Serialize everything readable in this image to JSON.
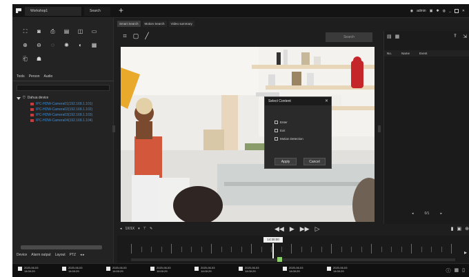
{
  "titlebar": {
    "tabs": [
      {
        "label": "Workshop1"
      },
      {
        "label": "Search"
      }
    ],
    "add_tab": "+",
    "user": "admin"
  },
  "left_panel": {
    "tabs": [
      "Tools",
      "Person",
      "Audio"
    ],
    "tree_root": "Dahua device",
    "tree_items": [
      {
        "label": "IPC-HDW-Camera01(192.168.1.101)"
      },
      {
        "label": "IPC-HDW-Camera02(192.168.1.102)"
      },
      {
        "label": "IPC-HDW-Camera03(192.168.1.103)"
      },
      {
        "label": "IPC-HDW-Camera04(192.168.1.104)"
      }
    ],
    "bottom_tabs": [
      "Device",
      "Alarm output",
      "Layout",
      "PTZ"
    ]
  },
  "center": {
    "view_tabs": [
      {
        "label": "Smart Search"
      },
      {
        "label": "Motion Search"
      },
      {
        "label": "Video summary"
      }
    ],
    "search_button": "Search"
  },
  "dialog": {
    "title": "Select Content",
    "options": [
      {
        "label": "Enter"
      },
      {
        "label": "Exit"
      },
      {
        "label": "Motion Detection"
      }
    ],
    "apply_label": "Apply",
    "cancel_label": "Cancel"
  },
  "right_panel": {
    "columns": [
      "No.",
      "Name",
      "Event"
    ],
    "page": "0/1"
  },
  "playback": {
    "speed": "1X/1X",
    "time_cursor": "14:30:00"
  },
  "bottom_strip": {
    "items": [
      {
        "date": "2020-06-03",
        "time": "14:00:29"
      },
      {
        "date": "2020-06-03",
        "time": "14:00:29"
      },
      {
        "date": "2020-06-03",
        "time": "14:00:29"
      },
      {
        "date": "2020-06-03",
        "time": "14:00:29"
      },
      {
        "date": "2020-06-03",
        "time": "14:00:29"
      },
      {
        "date": "2020-06-03",
        "time": "14:00:29"
      },
      {
        "date": "2020-06-03",
        "time": "14:00:29"
      },
      {
        "date": "2020-06-03",
        "time": "14:00:29"
      }
    ]
  },
  "colors": {
    "accent_link": "#3f8fd8",
    "timeline_marker": "#8bd06b"
  }
}
